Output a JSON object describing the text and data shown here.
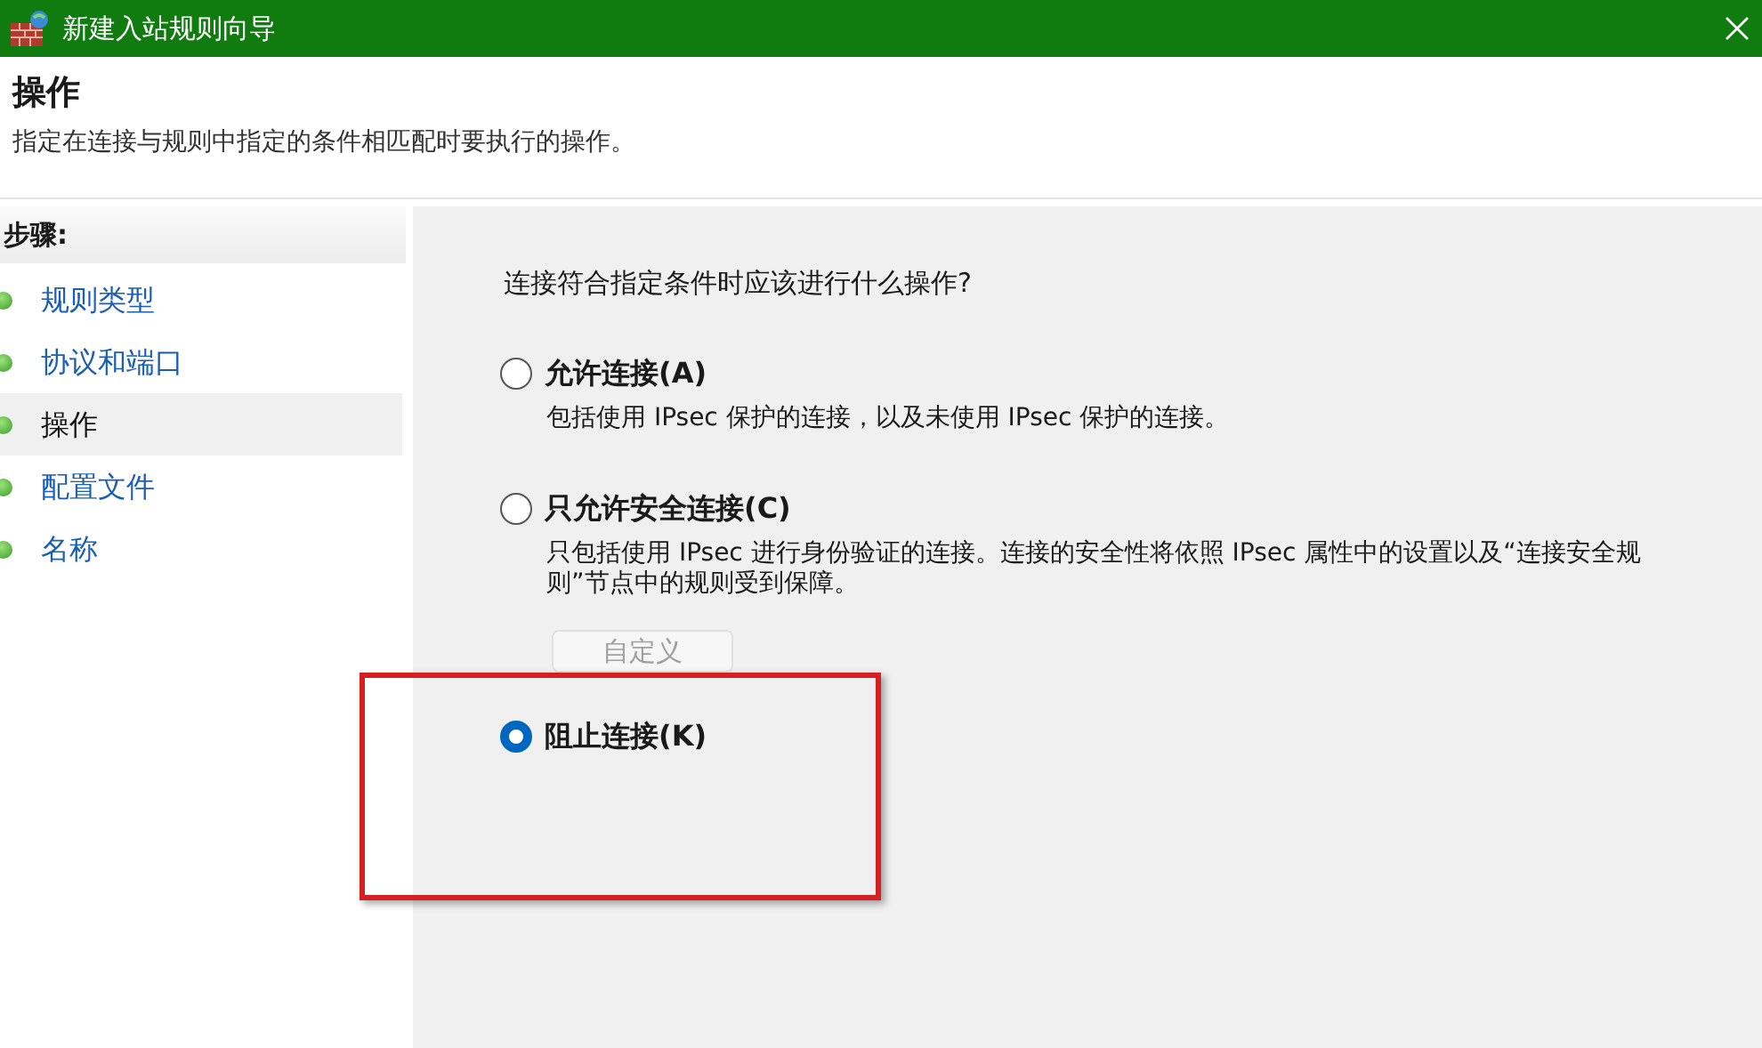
{
  "window": {
    "title": "新建入站规则向导"
  },
  "header": {
    "title": "操作",
    "description": "指定在连接与规则中指定的条件相匹配时要执行的操作。"
  },
  "steps": {
    "heading": "步骤:",
    "items": [
      {
        "label": "规则类型",
        "selected": false
      },
      {
        "label": "协议和端口",
        "selected": false
      },
      {
        "label": "操作",
        "selected": true
      },
      {
        "label": "配置文件",
        "selected": false
      },
      {
        "label": "名称",
        "selected": false
      }
    ]
  },
  "content": {
    "question": "连接符合指定条件时应该进行什么操作?",
    "options": [
      {
        "label": "允许连接(A)",
        "description": "包括使用 IPsec 保护的连接，以及未使用 IPsec 保护的连接。",
        "selected": false
      },
      {
        "label": "只允许安全连接(C)",
        "description": "只包括使用 IPsec 进行身份验证的连接。连接的安全性将依照 IPsec 属性中的设置以及“连接安全规则”节点中的规则受到保障。",
        "selected": false,
        "button": {
          "label": "自定义",
          "disabled": true
        }
      },
      {
        "label": "阻止连接(K)",
        "selected": true
      }
    ]
  },
  "annotation": {
    "kind": "highlight-box"
  }
}
